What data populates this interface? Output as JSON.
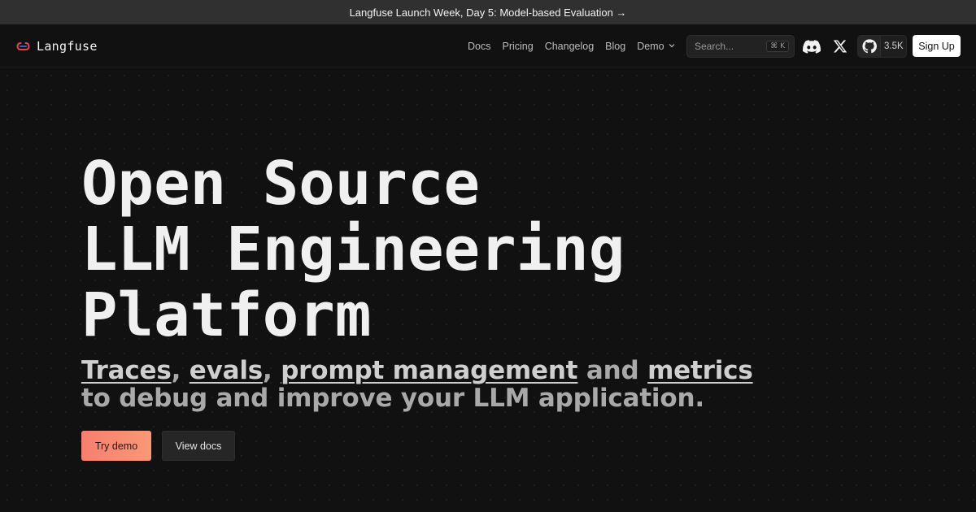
{
  "announcement": {
    "text": "Langfuse Launch Week, Day 5: Model-based Evaluation →"
  },
  "nav": {
    "brand": "Langfuse",
    "links": [
      "Docs",
      "Pricing",
      "Changelog",
      "Blog",
      "Demo"
    ],
    "search_placeholder": "Search...",
    "search_shortcut": "⌘ K",
    "github_stars": "3.5K",
    "signup_label": "Sign Up",
    "icons": [
      "discord-icon",
      "x-icon",
      "github-icon",
      "chevron-down-icon",
      "langfuse-logo-icon"
    ]
  },
  "hero": {
    "headline": [
      "Open Source",
      "LLM Engineering",
      "Platform"
    ],
    "sub": {
      "traces": "Traces",
      "sep1": ", ",
      "evals": "evals",
      "sep2": ", ",
      "prompt_management": "prompt management",
      "and": " and ",
      "metrics": "metrics",
      "line2": "to debug and improve your LLM application."
    },
    "primary_button": "Try demo",
    "secondary_button": "View docs"
  },
  "colors": {
    "background": "#111111",
    "banner": "#303030",
    "accent_start": "#f77f6f",
    "accent_end": "#f99876",
    "logo_red": "#e8454b",
    "logo_blue": "#3b5bdb"
  }
}
